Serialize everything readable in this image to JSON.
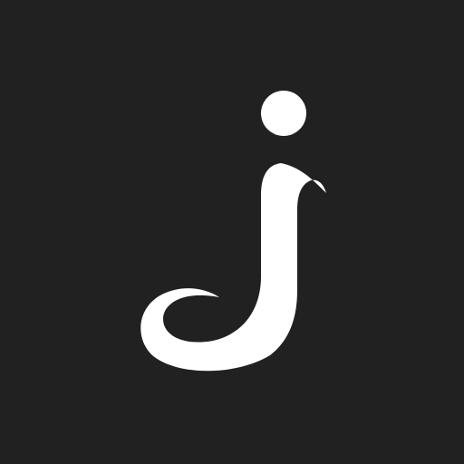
{
  "icon": {
    "name": "letter-j-logo-icon",
    "background_color": "#212121",
    "glyph_color": "#FFFFFF"
  }
}
